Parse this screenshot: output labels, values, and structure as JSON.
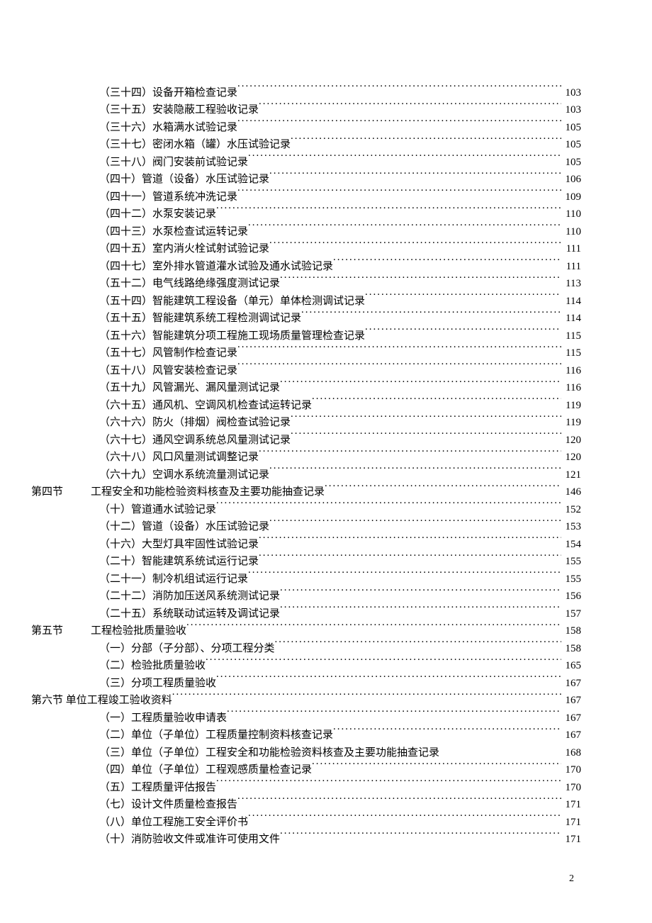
{
  "footer_page": "2",
  "entries": [
    {
      "label": "",
      "title": "（三十四）设备开箱检查记录",
      "page": "103"
    },
    {
      "label": "",
      "title": "（三十五）安装隐蔽工程验收记录",
      "page": "103"
    },
    {
      "label": "",
      "title": "（三十六）水箱满水试验记录",
      "page": "105"
    },
    {
      "label": "",
      "title": "（三十七）密闭水箱（罐）水压试验记录",
      "page": "105"
    },
    {
      "label": "",
      "title": "（三十八）阀门安装前试验记录",
      "page": "105"
    },
    {
      "label": "",
      "title": "（四十）管道（设备）水压试验记录",
      "page": "106"
    },
    {
      "label": "",
      "title": "（四十一）管道系统冲洗记录",
      "page": "109"
    },
    {
      "label": "",
      "title": "（四十二）水泵安装记录",
      "page": "110"
    },
    {
      "label": "",
      "title": "（四十三）水泵检查试运转记录",
      "page": "110"
    },
    {
      "label": "",
      "title": "（四十五）室内消火栓试射试验记录",
      "page": "111"
    },
    {
      "label": "",
      "title": "（四十七）室外排水管道灌水试验及通水试验记录",
      "page": "111"
    },
    {
      "label": "",
      "title": "（五十二）电气线路绝缘强度测试记录",
      "page": "113"
    },
    {
      "label": "",
      "title": "（五十四）智能建筑工程设备（单元）单体检测调试记录",
      "page": "114"
    },
    {
      "label": "",
      "title": "（五十五）智能建筑系统工程检测调试记录",
      "page": "114"
    },
    {
      "label": "",
      "title": "（五十六）智能建筑分项工程施工现场质量管理检查记录",
      "page": "115"
    },
    {
      "label": "",
      "title": "（五十七）风管制作检查记录",
      "page": "115"
    },
    {
      "label": "",
      "title": "（五十八）风管安装检查记录",
      "page": "116"
    },
    {
      "label": "",
      "title": "（五十九）风管漏光、漏风量测试记录",
      "page": "116"
    },
    {
      "label": "",
      "title": "（六十五）通风机、空调风机检查试运转记录",
      "page": "119"
    },
    {
      "label": "",
      "title": "（六十六）防火（排烟）阀检查试验记录",
      "page": "119"
    },
    {
      "label": "",
      "title": "（六十七）通风空调系统总风量测试记录",
      "page": "120"
    },
    {
      "label": "",
      "title": "（六十八）风口风量测试调整记录",
      "page": "120"
    },
    {
      "label": "",
      "title": "（六十九）空调水系统流量测试记录",
      "page": "121"
    },
    {
      "label": "第四节",
      "title": "工程安全和功能检验资料核查及主要功能抽查记录",
      "page": "146"
    },
    {
      "label": "",
      "title": "（十）管道通水试验记录",
      "page": "152"
    },
    {
      "label": "",
      "title": "（十二）管道（设备）水压试验记录",
      "page": "153"
    },
    {
      "label": "",
      "title": "（十六）大型灯具牢固性试验记录",
      "page": "154"
    },
    {
      "label": "",
      "title": "（二十）智能建筑系统试运行记录",
      "page": "155"
    },
    {
      "label": "",
      "title": "（二十一）制冷机组试运行记录",
      "page": "155"
    },
    {
      "label": "",
      "title": "（二十二）消防加压送风系统测试记录",
      "page": "156"
    },
    {
      "label": "",
      "title": "（二十五）系统联动试运转及调试记录",
      "page": "157"
    },
    {
      "label": "第五节",
      "title": "工程检验批质量验收",
      "page": "158"
    },
    {
      "label": "",
      "title": "（一）分部（子分部）、分项工程分类",
      "page": "158"
    },
    {
      "label": "",
      "title": "（二）检验批质量验收",
      "page": "165"
    },
    {
      "label": "",
      "title": "（三）分项工程质量验收",
      "page": "167"
    },
    {
      "label": "第六节 单位工程竣工验收资料",
      "title": "",
      "page": "167",
      "outdent": true
    },
    {
      "label": "",
      "title": "（一）工程质量验收申请表",
      "page": "167"
    },
    {
      "label": "",
      "title": "（二）单位（子单位）工程质量控制资料核查记录",
      "page": "167"
    },
    {
      "label": "",
      "title": "（三）单位（子单位）工程安全和功能检验资料核查及主要功能抽查记录",
      "page": "168",
      "nodots": true
    },
    {
      "label": "",
      "title": "（四）单位（子单位）工程观感质量检查记录",
      "page": "170"
    },
    {
      "label": "",
      "title": "（五）工程质量评估报告",
      "page": "170"
    },
    {
      "label": "",
      "title": "（七）设计文件质量检查报告",
      "page": "171"
    },
    {
      "label": "",
      "title": "（八）单位工程施工安全评价书",
      "page": "171"
    },
    {
      "label": "",
      "title": "（十）消防验收文件或准许可使用文件",
      "page": "171"
    }
  ]
}
